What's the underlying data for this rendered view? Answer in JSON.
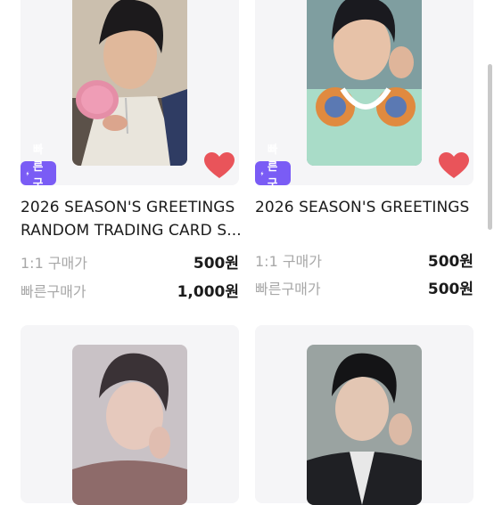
{
  "products": [
    {
      "badge": "빠른구매",
      "title_line1": "2026 SEASON'S GREETINGS",
      "title_line2": "RANDOM TRADING CARD S...",
      "price1_label": "1:1 구매가",
      "price1_value": "500원",
      "price2_label": "빠른구매가",
      "price2_value": "1,000원",
      "liked": true
    },
    {
      "badge": "빠른구매",
      "title_line1": "2026 SEASON'S GREETINGS",
      "title_line2": "",
      "price1_label": "1:1 구매가",
      "price1_value": "500원",
      "price2_label": "빠른구매가",
      "price2_value": "500원",
      "liked": true
    },
    {
      "photo": "photocard-3"
    },
    {
      "photo": "photocard-4"
    }
  ],
  "colors": {
    "badge": "#7a5cf5",
    "heart": "#e9545a",
    "card_bg": "#f5f5f7"
  }
}
